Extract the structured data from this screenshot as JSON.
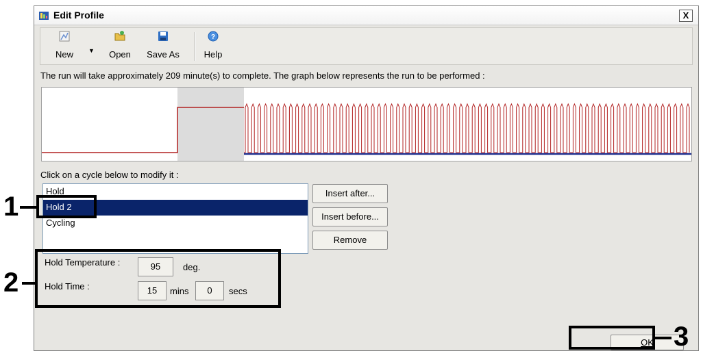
{
  "window": {
    "title": "Edit Profile",
    "close_symbol": "X"
  },
  "toolbar": {
    "new_label": "New",
    "new_dropdown_symbol": "▼",
    "open_label": "Open",
    "save_as_label": "Save As",
    "help_label": "Help"
  },
  "info_text": "The run will take approximately 209 minute(s) to complete. The graph below represents the run to be performed :",
  "cycles": {
    "label": "Click on a cycle below to modify it :",
    "items": [
      "Hold",
      "Hold 2",
      "Cycling"
    ],
    "selected_index": 1
  },
  "buttons": {
    "insert_after": "Insert after...",
    "insert_before": "Insert before...",
    "remove": "Remove",
    "ok": "OK"
  },
  "hold": {
    "temperature_label": "Hold Temperature :",
    "temperature_value": "95",
    "temperature_unit": "deg.",
    "time_label": "Hold Time :",
    "minutes_value": "15",
    "minutes_unit": "mins",
    "seconds_value": "0",
    "seconds_unit": "secs"
  },
  "callouts": {
    "one": "1",
    "two": "2",
    "three": "3"
  },
  "colors": {
    "profile_line": "#b22222",
    "cycle_line": "#1f2f8f",
    "selection": "#0a246a"
  }
}
